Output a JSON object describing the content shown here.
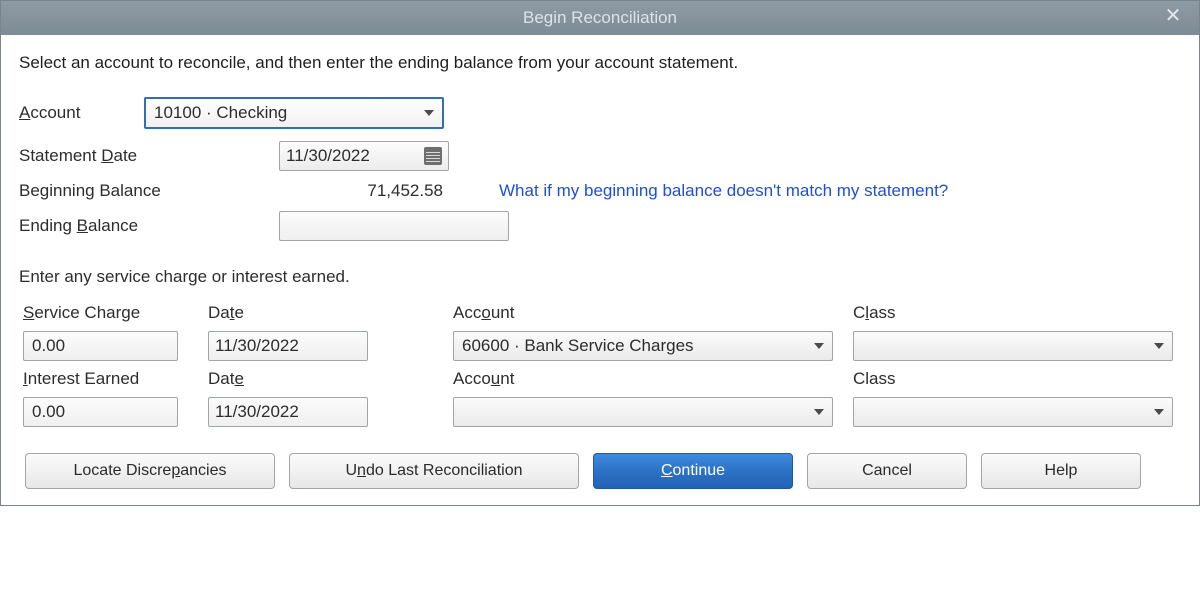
{
  "title": "Begin Reconciliation",
  "instruction": "Select an account to reconcile, and then enter the ending balance from your account statement.",
  "labels": {
    "account": "ccount",
    "account_prefix": "A",
    "statement_date": "Statement ",
    "statement_date_u": "D",
    "statement_date_suffix": "ate",
    "beginning_balance": "Beginning Balance",
    "ending_balance": "Ending ",
    "ending_balance_u": "B",
    "ending_balance_suffix": "alance",
    "section2": "Enter any service charge or interest earned.",
    "service_charge_u": "S",
    "service_charge": "ervice Charge",
    "date1_pre": "Da",
    "date1_u": "t",
    "date1_suf": "e",
    "account2_pre": "Acc",
    "account2_u": "o",
    "account2_suf": "unt",
    "class_pre": "C",
    "class_u": "l",
    "class_suf": "ass",
    "interest_u": "I",
    "interest": "nterest Earned",
    "date2_pre": "Dat",
    "date2_u": "e",
    "date2_suf": "",
    "account3_pre": "Acco",
    "account3_u": "u",
    "account3_suf": "nt",
    "class2": "Class"
  },
  "help_link": "What if my beginning balance doesn't match my statement?",
  "account_combo": "10100 · Checking",
  "statement_date": "11/30/2022",
  "beginning_balance": "71,452.58",
  "ending_balance": "",
  "service_charge": {
    "amount": "0.00",
    "date": "11/30/2022",
    "account": "60600 · Bank Service Charges",
    "class": ""
  },
  "interest_earned": {
    "amount": "0.00",
    "date": "11/30/2022",
    "account": "",
    "class": ""
  },
  "buttons": {
    "locate_pre": "Locate Discre",
    "locate_u": "p",
    "locate_suf": "ancies",
    "undo_pre": "U",
    "undo_u": "n",
    "undo_suf": "do Last Reconciliation",
    "continue_u": "C",
    "continue_suf": "ontinue",
    "cancel": "Cancel",
    "help": "Help"
  }
}
